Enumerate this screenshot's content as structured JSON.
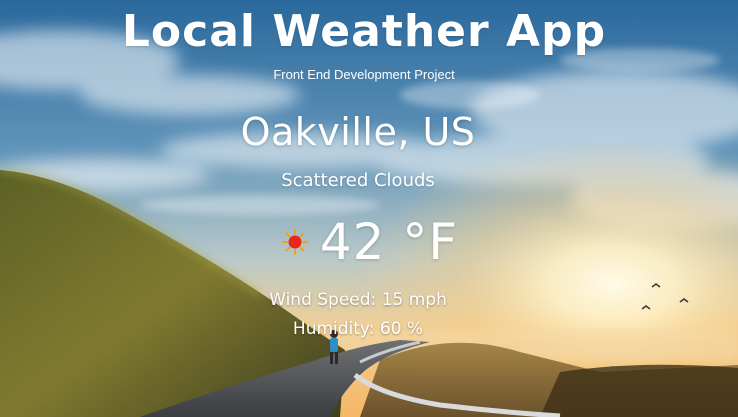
{
  "app": {
    "title": "Local Weather App",
    "subtitle": "Front End Development Project"
  },
  "weather": {
    "location": "Oakville, US",
    "condition": "Scattered Clouds",
    "temperature": "42 °F",
    "icon": "sun-icon",
    "wind_speed": "Wind Speed: 15 mph",
    "humidity": "Humidity: 60 %"
  },
  "colors": {
    "sky_top": "#2f6fa3",
    "sky_mid": "#7fa8c4",
    "horizon": "#f3c27a",
    "sun_glow": "#fff6d8",
    "hill": "#6b6a2e",
    "road": "#4a4e52",
    "icon_sun": "#e8261c",
    "icon_rays": "#f2a11a",
    "text": "#ffffff"
  }
}
